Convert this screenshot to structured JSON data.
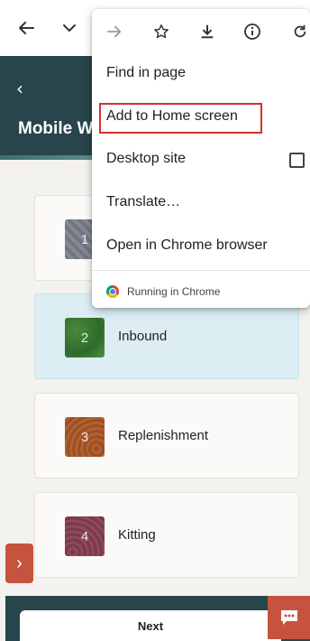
{
  "browser": {
    "back_icon": "arrow-left-icon",
    "tabs_icon": "chevron-down-icon"
  },
  "header": {
    "back_glyph": "‹",
    "title": "Mobile W"
  },
  "steps": [
    {
      "number": "1",
      "label": ""
    },
    {
      "number": "2",
      "label": "Inbound"
    },
    {
      "number": "3",
      "label": "Replenishment"
    },
    {
      "number": "4",
      "label": "Kitting"
    }
  ],
  "side_tab": {
    "glyph": "›"
  },
  "footer": {
    "next_label": "Next"
  },
  "menu": {
    "icons": [
      "forward-icon",
      "star-icon",
      "download-icon",
      "info-icon",
      "reload-icon"
    ],
    "items": [
      "Find in page",
      "Add to Home screen",
      "Desktop site",
      "Translate…",
      "Open in Chrome browser"
    ],
    "running": "Running in Chrome",
    "desktop_site_checked": false
  },
  "colors": {
    "header_bg": "#27454a",
    "accent": "#c6533d",
    "active_card": "#dceef3",
    "highlight": "#d0312d"
  }
}
